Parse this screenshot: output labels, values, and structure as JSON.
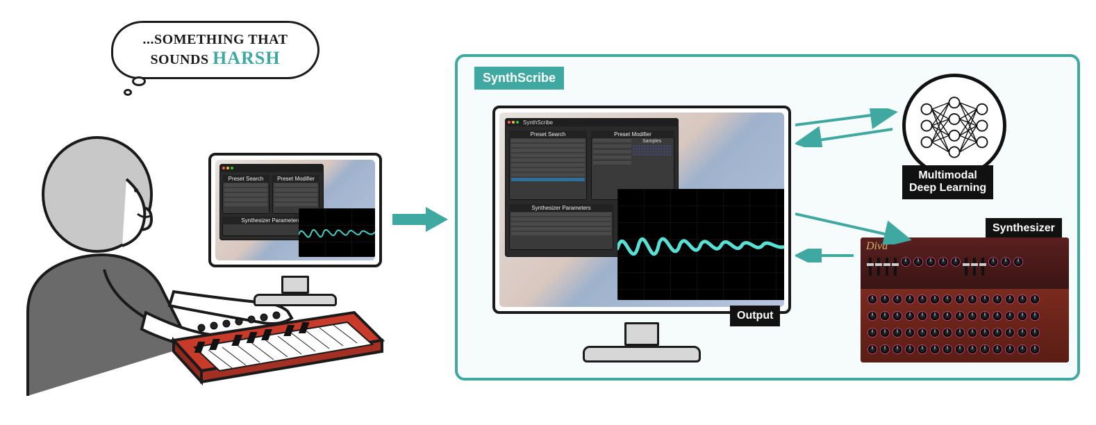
{
  "thought": {
    "prefix": "...SOMETHING THAT",
    "line2_prefix": "SOUNDS",
    "accent": "HARSH"
  },
  "right": {
    "title": "SynthScribe",
    "output_label": "Output",
    "ml_label_line1": "Multimodal",
    "ml_label_line2": "Deep Learning",
    "synth_label": "Synthesizer",
    "synth_brand": "Diva"
  },
  "app": {
    "title": "SynthScribe",
    "panels": {
      "search": "Preset Search",
      "modifier": "Preset Modifier",
      "params": "Synthesizer Parameters",
      "samples": "Samples"
    }
  }
}
